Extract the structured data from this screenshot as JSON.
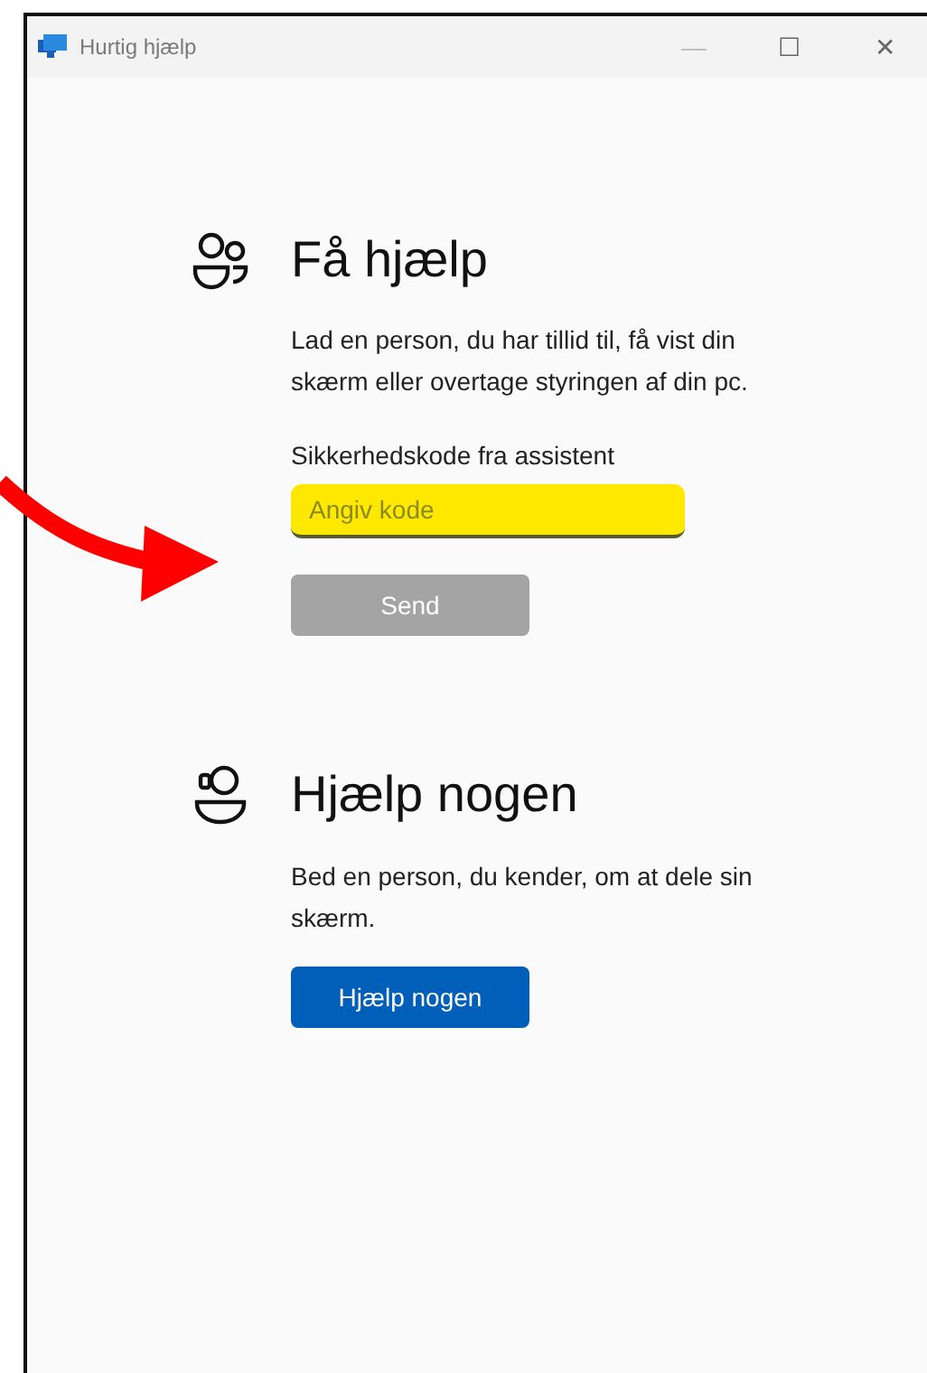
{
  "window": {
    "title": "Hurtig hjælp",
    "controls": [
      "—",
      "☐",
      "✕"
    ]
  },
  "sections": [
    {
      "kind": "people",
      "heading": "Få hjælp",
      "text": "Lad en person, du har tillid til, få vist din skærm eller overtage styringen af din pc.",
      "field": {
        "label": "Sikkerhedskode fra assistent",
        "placeholder": "Angiv kode",
        "highlighted": true
      },
      "button": {
        "label": "Send",
        "disabled": true
      }
    },
    {
      "kind": "helper",
      "heading": "Hjælp nogen",
      "text": "Bed en person, du kender, om at dele sin skærm.",
      "button": {
        "label": "Hjælp nogen",
        "disabled": false
      }
    }
  ],
  "annotations": [
    {
      "kind": "arrow"
    }
  ]
}
